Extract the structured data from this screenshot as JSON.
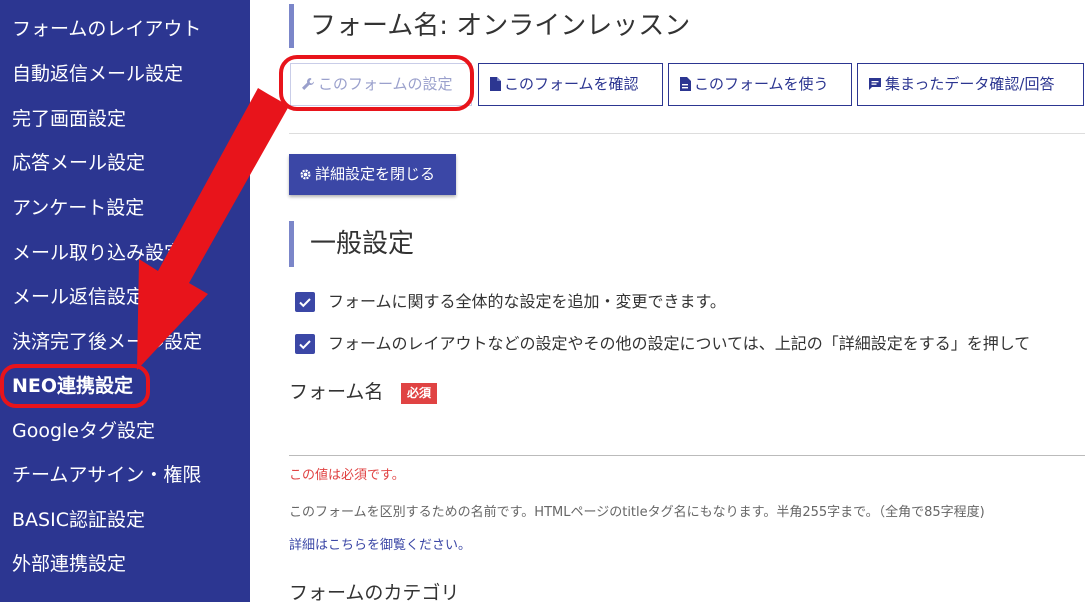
{
  "sidebar": {
    "items": [
      {
        "label": "フォームのレイアウト"
      },
      {
        "label": "自動返信メール設定"
      },
      {
        "label": "完了画面設定"
      },
      {
        "label": "応答メール設定"
      },
      {
        "label": "アンケート設定"
      },
      {
        "label": "メール取り込み設定"
      },
      {
        "label": "メール返信設定"
      },
      {
        "label": "決済完了後メール設定"
      },
      {
        "label": "NEO連携設定"
      },
      {
        "label": "Googleタグ設定"
      },
      {
        "label": "チームアサイン・権限"
      },
      {
        "label": "BASIC認証設定"
      },
      {
        "label": "外部連携設定"
      }
    ]
  },
  "header": {
    "title": "フォーム名: オンラインレッスン"
  },
  "toolbar": {
    "settings_label": "このフォームの設定",
    "confirm_label": "このフォームを確認",
    "use_label": "このフォームを使う",
    "data_label": "集まったデータ確認/回答"
  },
  "advanced_button": {
    "label": "詳細設定を閉じる"
  },
  "general": {
    "title": "一般設定",
    "notes": [
      "フォームに関する全体的な設定を追加・変更できます。",
      "フォームのレイアウトなどの設定やその他の設定については、上記の「詳細設定をする」を押して"
    ]
  },
  "form_name": {
    "label": "フォーム名",
    "required_badge": "必須",
    "value": "",
    "error": "この値は必須です。",
    "help": "このフォームを区別するための名前です。HTMLページのtitleタグ名にもなります。半角255字まで。（全角で85字程度)",
    "details_link": "詳細はこちらを御覧ください。"
  },
  "category": {
    "label": "フォームのカテゴリ"
  },
  "colors": {
    "sidebar_bg": "#2c3691",
    "primary": "#3b47a6",
    "accent_bar": "#7b86c9",
    "required_badge": "#e04343",
    "annotation_red": "#e8141b"
  },
  "icons": [
    "wrench-icon",
    "document-icon",
    "document-icon",
    "comment-icon",
    "gear-icon",
    "checkbox-icon"
  ]
}
